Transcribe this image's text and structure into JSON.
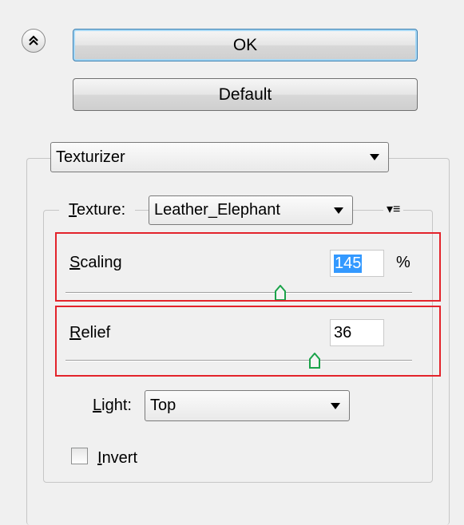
{
  "buttons": {
    "ok_label": "OK",
    "default_label": "Default"
  },
  "filter": {
    "selected": "Texturizer"
  },
  "texture": {
    "label": "Texture:",
    "selected": "Leather_Elephant",
    "menu_glyph": "▾≡"
  },
  "scaling": {
    "label": "Scaling",
    "value": "145",
    "unit": "%",
    "slider_fraction": 0.62
  },
  "relief": {
    "label": "Relief",
    "value": "36",
    "slider_fraction": 0.72
  },
  "light": {
    "label": "Light:",
    "selected": "Top"
  },
  "invert": {
    "label": "Invert",
    "checked": false
  },
  "icons": {
    "collapse": "double-chevron-up-icon"
  },
  "colors": {
    "highlight": "#e3232b",
    "selection": "#3399ff",
    "thumb": "#1aa34a"
  }
}
